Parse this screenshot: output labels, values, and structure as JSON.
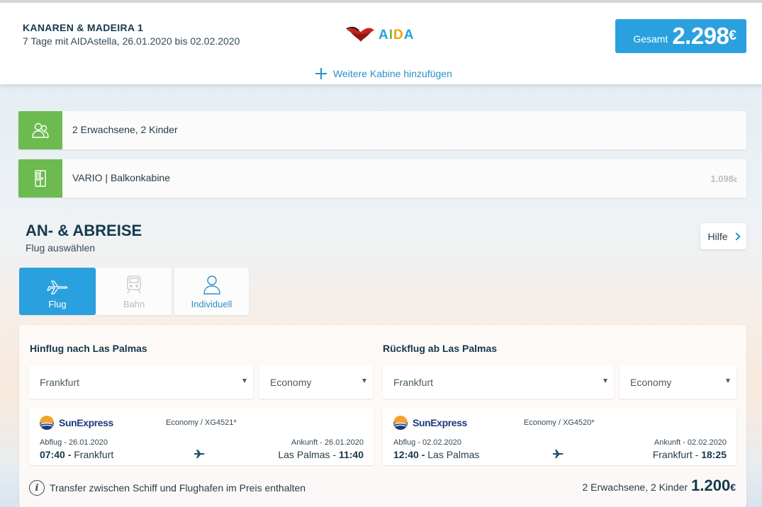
{
  "header": {
    "cruise_name": "KANAREN & MADEIRA 1",
    "cruise_details": "7 Tage mit AIDAstella, 26.01.2020 bis 02.02.2020",
    "logo_text": "AIDA",
    "total_label": "Gesamt",
    "total_value": "2.298",
    "currency": "€",
    "add_cabin_label": "Weitere Kabine hinzufügen"
  },
  "summary": {
    "travelers": "2 Erwachsene, 2 Kinder",
    "cabin": "VARIO | Balkonkabine",
    "cabin_price": "1.098",
    "currency": "€"
  },
  "section": {
    "title": "AN- & ABREISE",
    "subtitle": "Flug auswählen",
    "help_label": "Hilfe"
  },
  "modes": {
    "flight": "Flug",
    "train": "Bahn",
    "individual": "Individuell"
  },
  "outbound": {
    "title": "Hinflug nach Las Palmas",
    "airport": "Frankfurt",
    "class": "Economy",
    "airline": "SunExpress",
    "fare": "Economy / XG4521*",
    "dep_label": "Abflug - 26.01.2020",
    "dep_time": "07:40 - ",
    "dep_place": "Frankfurt",
    "arr_label": "Ankunft - 26.01.2020",
    "arr_place": "Las Palmas - ",
    "arr_time": "11:40"
  },
  "return": {
    "title": "Rückflug ab Las Palmas",
    "airport": "Frankfurt",
    "class": "Economy",
    "airline": "SunExpress",
    "fare": "Economy / XG4520*",
    "dep_label": "Abflug - 02.02.2020",
    "dep_time": "12:40 - ",
    "dep_place": "Las Palmas",
    "arr_label": "Ankunft - 02.02.2020",
    "arr_place": "Frankfurt - ",
    "arr_time": "18:25"
  },
  "footer": {
    "transfer_note": "Transfer zwischen Schiff und Flughafen im Preis enthalten",
    "price_label": "2 Erwachsene, 2 Kinder",
    "price_value": "1.200",
    "currency": "€"
  },
  "colors": {
    "accent_blue": "#2aa1de",
    "green": "#6cba50",
    "dark_text": "#16384c"
  },
  "icons": [
    "plus-icon",
    "travelers-icon",
    "cabin-icon",
    "chevron-right-icon",
    "plane-icon",
    "train-icon",
    "person-icon",
    "airline-logo-icon",
    "info-icon"
  ]
}
